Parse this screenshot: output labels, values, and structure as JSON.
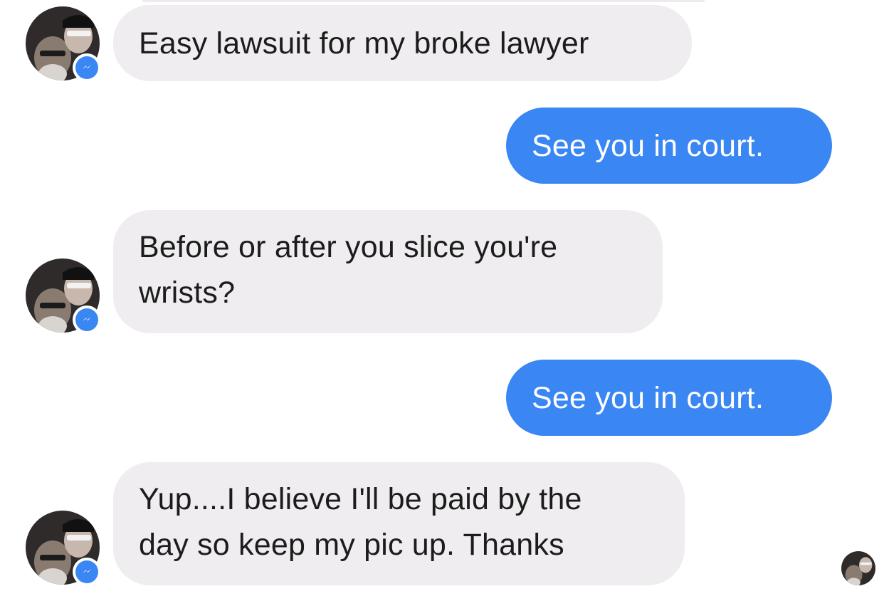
{
  "conversation": {
    "messages": [
      {
        "sender": "them",
        "text": "Easy lawsuit for my broke lawyer"
      },
      {
        "sender": "me",
        "text": "See you in court."
      },
      {
        "sender": "them",
        "text": "Before or after you slice you're\nwrists?"
      },
      {
        "sender": "me",
        "text": "See you in court."
      },
      {
        "sender": "them",
        "text": "Yup....I believe I'll be paid by the\nday so keep my pic up.  Thanks"
      }
    ]
  },
  "icons": {
    "avatar": "contact-avatar-photo",
    "badge": "messenger-badge-icon",
    "receipt": "read-receipt-avatar"
  },
  "colors": {
    "incoming_bubble": "#efedef",
    "outgoing_bubble": "#3a86f2",
    "background": "#ffffff",
    "badge": "#3a86f2"
  }
}
